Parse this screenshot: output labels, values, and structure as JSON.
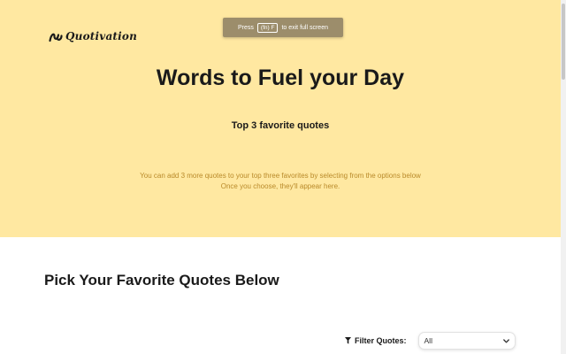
{
  "brand": {
    "logo_text": "Quotivation",
    "logo_icon": "squiggle-logo-icon"
  },
  "fullscreen_toast": {
    "press": "Press",
    "key": "(fn) F",
    "rest": "to exit full screen"
  },
  "hero": {
    "title": "Words to Fuel your Day",
    "subtitle": "Top 3 favorite quotes",
    "note_line1": "You can add 3 more quotes to your top three favorites by selecting from the options below",
    "note_line2": "Once you choose, they'll appear here."
  },
  "picker": {
    "title": "Pick Your Favorite Quotes Below",
    "filter_label": "Filter Quotes:",
    "filter_icon": "funnel-icon",
    "filter_value": "All"
  },
  "colors": {
    "hero_bg": "#ffe8a1",
    "note_text": "#b98a2a",
    "toast_bg": "#9c8d6b"
  }
}
